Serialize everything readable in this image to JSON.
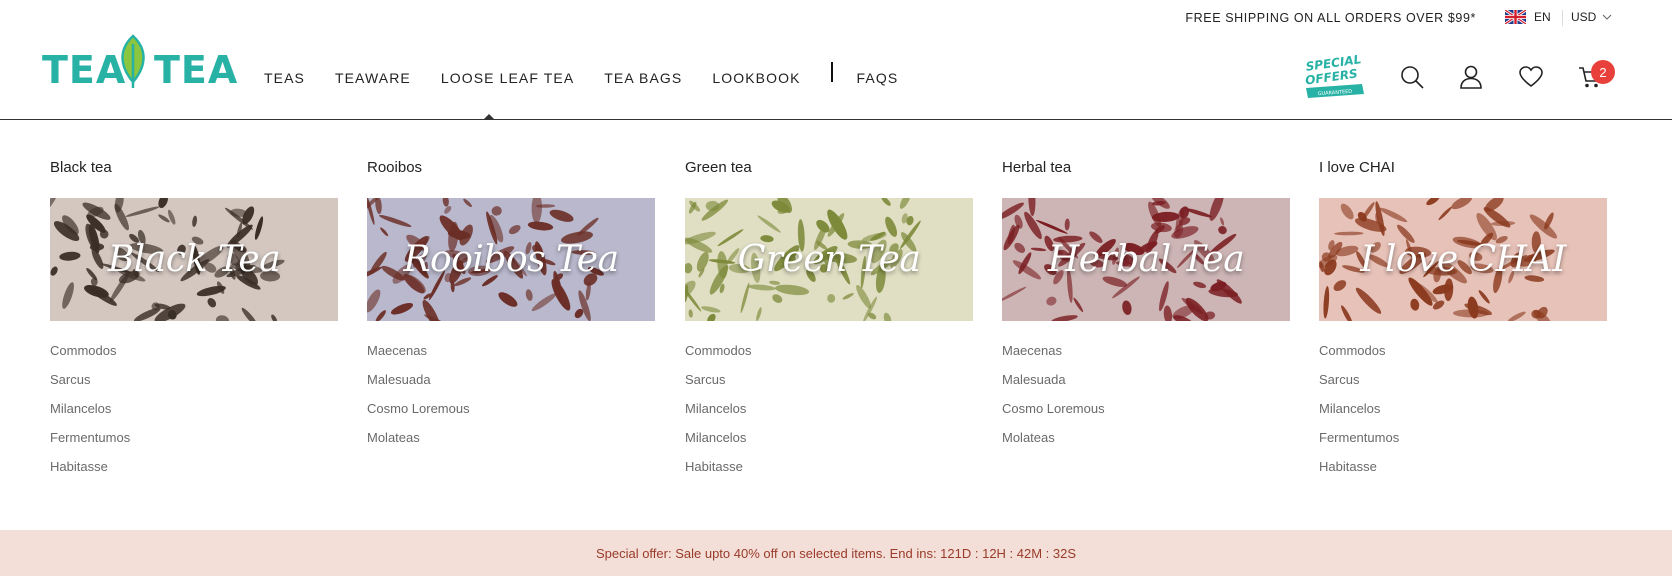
{
  "topbar": {
    "shipping_text": "FREE SHIPPING ON ALL ORDERS OVER $99*",
    "language": "EN",
    "currency": "USD"
  },
  "logo": {
    "left": "TEA",
    "right": "TEA"
  },
  "nav": {
    "items": [
      "TEAS",
      "TEAWARE",
      "LOOSE LEAF TEA",
      "TEA BAGS",
      "LOOKBOOK",
      "FAQS"
    ]
  },
  "special_offers": {
    "line1": "SPECIAL",
    "line2": "OFFERS",
    "ribbon": "GUARANTEED"
  },
  "cart": {
    "count": "2"
  },
  "colors": {
    "brand": "#27b2a5",
    "badge": "#e8413b",
    "offer_bg": "#f3dfd7",
    "offer_text": "#9a3b2a"
  },
  "menu": {
    "columns": [
      {
        "title": "Black tea",
        "banner": "Black Tea",
        "bg": "#d4c7c0",
        "leaf": "#3a2e26",
        "links": [
          "Commodos",
          "Sarcus",
          "Milancelos",
          "Fermentumos",
          "Habitasse"
        ]
      },
      {
        "title": "Rooibos",
        "banner": "Rooibos Tea",
        "bg": "#b9b8cc",
        "leaf": "#6b2e26",
        "links": [
          "Maecenas",
          "Malesuada",
          "Cosmo Loremous",
          "Molateas"
        ]
      },
      {
        "title": "Green tea",
        "banner": "Green Tea",
        "bg": "#e0dfc3",
        "leaf": "#7d8a3a",
        "links": [
          "Commodos",
          "Sarcus",
          "Milancelos",
          "Milancelos",
          "Habitasse"
        ]
      },
      {
        "title": "Herbal tea",
        "banner": "Herbal Tea",
        "bg": "#cdb5b5",
        "leaf": "#7a1e22",
        "links": [
          "Maecenas",
          "Malesuada",
          "Cosmo Loremous",
          "Molateas"
        ]
      },
      {
        "title": "I love CHAI",
        "banner": "I love CHAI",
        "bg": "#e7c2b8",
        "leaf": "#8b3a1e",
        "links": [
          "Commodos",
          "Sarcus",
          "Milancelos",
          "Fermentumos",
          "Habitasse"
        ]
      }
    ]
  },
  "offer": {
    "text": "Special offer: Sale upto 40% off on selected items. End ins: 121D : 12H : 42M : 32S"
  }
}
